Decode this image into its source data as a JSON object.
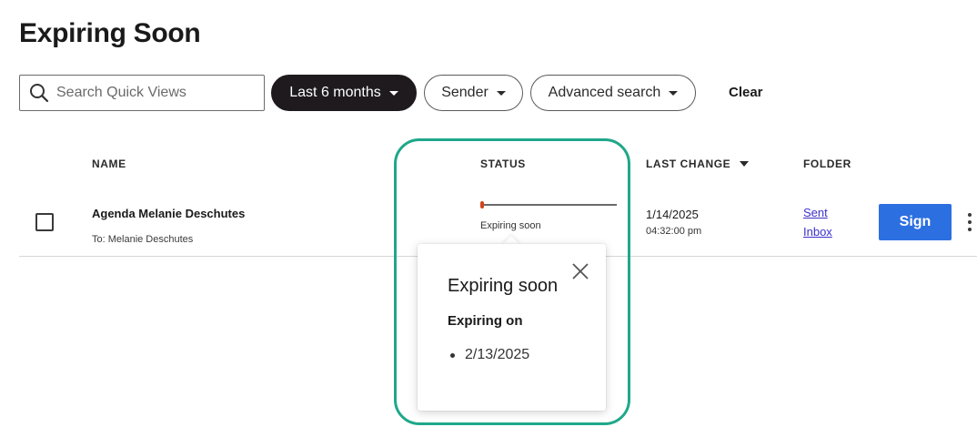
{
  "page": {
    "title": "Expiring Soon"
  },
  "filters": {
    "search_placeholder": "Search Quick Views",
    "date_range": "Last 6 months",
    "sender": "Sender",
    "advanced": "Advanced search",
    "clear": "Clear"
  },
  "table": {
    "columns": {
      "name": "NAME",
      "status": "STATUS",
      "last_change": "LAST CHANGE",
      "folder": "FOLDER"
    },
    "rows": [
      {
        "name": "Agenda Melanie Deschutes",
        "recipient": "To: Melanie Deschutes",
        "status": "Expiring soon",
        "progress": 0.02,
        "last_change_date": "1/14/2025",
        "last_change_time": "04:32:00 pm",
        "folders": [
          "Sent",
          "Inbox"
        ],
        "action": "Sign"
      }
    ]
  },
  "popover": {
    "title": "Expiring soon",
    "subtitle": "Expiring on",
    "items": [
      "2/13/2025"
    ]
  },
  "colors": {
    "primary_button": "#2c6fe0",
    "dark_pill": "#1e1a1d",
    "highlight_ring": "#1fa88a",
    "status_progress": "#d4451c",
    "link": "#3b2fc9"
  },
  "icons": {
    "search": "search-icon",
    "caret": "caret-down-icon",
    "close": "close-icon",
    "more": "more-vertical-icon"
  }
}
